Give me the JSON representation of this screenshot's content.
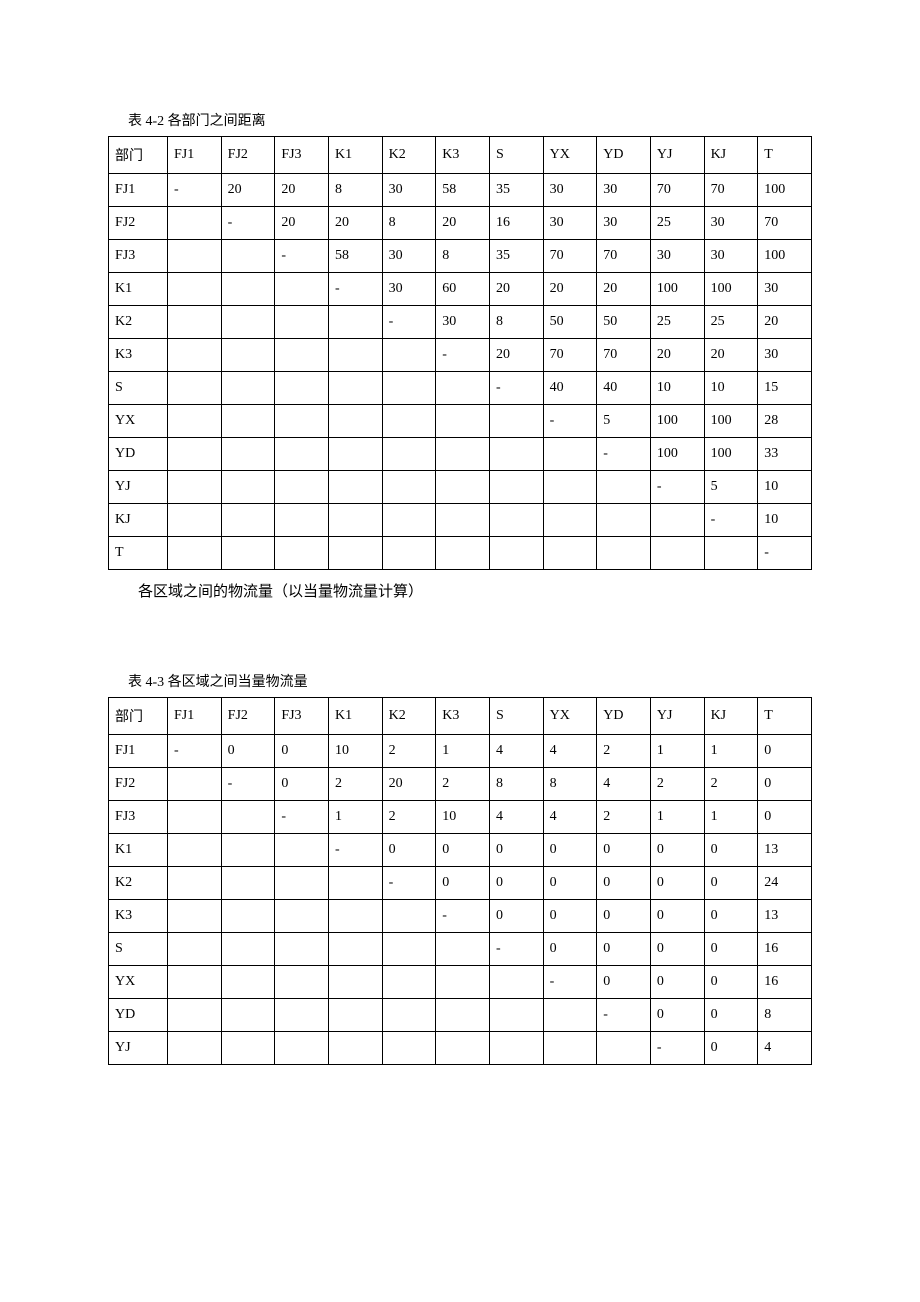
{
  "table1": {
    "caption": "表 4-2  各部门之间距离",
    "header": [
      "部门",
      "FJ1",
      "FJ2",
      "FJ3",
      "K1",
      "K2",
      "K3",
      "S",
      "YX",
      "YD",
      "YJ",
      "KJ",
      "T"
    ],
    "rows": [
      [
        "FJ1",
        "-",
        "20",
        "20",
        "8",
        "30",
        "58",
        "35",
        "30",
        "30",
        "70",
        "70",
        "100"
      ],
      [
        "FJ2",
        "",
        "-",
        "20",
        "20",
        "8",
        "20",
        "16",
        "30",
        "30",
        "25",
        "30",
        "70"
      ],
      [
        "FJ3",
        "",
        "",
        "-",
        "58",
        "30",
        "8",
        "35",
        "70",
        "70",
        "30",
        "30",
        "100"
      ],
      [
        "K1",
        "",
        "",
        "",
        "-",
        "30",
        "60",
        "20",
        "20",
        "20",
        "100",
        "100",
        "30"
      ],
      [
        "K2",
        "",
        "",
        "",
        "",
        "-",
        "30",
        "8",
        "50",
        "50",
        "25",
        "25",
        "20"
      ],
      [
        "K3",
        "",
        "",
        "",
        "",
        "",
        "-",
        "20",
        "70",
        "70",
        "20",
        "20",
        "30"
      ],
      [
        "S",
        "",
        "",
        "",
        "",
        "",
        "",
        "-",
        "40",
        "40",
        "10",
        "10",
        "15"
      ],
      [
        "YX",
        "",
        "",
        "",
        "",
        "",
        "",
        "",
        "-",
        "5",
        "100",
        "100",
        "28"
      ],
      [
        "YD",
        "",
        "",
        "",
        "",
        "",
        "",
        "",
        "",
        "-",
        "100",
        "100",
        "33"
      ],
      [
        "YJ",
        "",
        "",
        "",
        "",
        "",
        "",
        "",
        "",
        "",
        "-",
        "5",
        "10"
      ],
      [
        "KJ",
        "",
        "",
        "",
        "",
        "",
        "",
        "",
        "",
        "",
        "",
        "-",
        "10"
      ],
      [
        "T",
        "",
        "",
        "",
        "",
        "",
        "",
        "",
        "",
        "",
        "",
        "",
        "-"
      ]
    ]
  },
  "middleText": "各区域之间的物流量（以当量物流量计算）",
  "table2": {
    "caption": "表 4-3  各区域之间当量物流量",
    "header": [
      "部门",
      "FJ1",
      "FJ2",
      "FJ3",
      "K1",
      "K2",
      "K3",
      "S",
      "YX",
      "YD",
      "YJ",
      "KJ",
      "T"
    ],
    "rows": [
      [
        "FJ1",
        "-",
        "0",
        "0",
        "10",
        "2",
        "1",
        "4",
        "4",
        "2",
        "1",
        "1",
        "0"
      ],
      [
        "FJ2",
        "",
        "-",
        "0",
        "2",
        "20",
        "2",
        "8",
        "8",
        "4",
        "2",
        "2",
        "0"
      ],
      [
        "FJ3",
        "",
        "",
        "-",
        "1",
        "2",
        "10",
        "4",
        "4",
        "2",
        "1",
        "1",
        "0"
      ],
      [
        "K1",
        "",
        "",
        "",
        "-",
        "0",
        "0",
        "0",
        "0",
        "0",
        "0",
        "0",
        "13"
      ],
      [
        "K2",
        "",
        "",
        "",
        "",
        "-",
        "0",
        "0",
        "0",
        "0",
        "0",
        "0",
        "24"
      ],
      [
        "K3",
        "",
        "",
        "",
        "",
        "",
        "-",
        "0",
        "0",
        "0",
        "0",
        "0",
        "13"
      ],
      [
        "S",
        "",
        "",
        "",
        "",
        "",
        "",
        "-",
        "0",
        "0",
        "0",
        "0",
        "16"
      ],
      [
        "YX",
        "",
        "",
        "",
        "",
        "",
        "",
        "",
        "-",
        "0",
        "0",
        "0",
        "16"
      ],
      [
        "YD",
        "",
        "",
        "",
        "",
        "",
        "",
        "",
        "",
        "-",
        "0",
        "0",
        "8"
      ],
      [
        "YJ",
        "",
        "",
        "",
        "",
        "",
        "",
        "",
        "",
        "",
        "-",
        "0",
        "4"
      ]
    ]
  },
  "chart_data": [
    {
      "type": "table",
      "title": "表 4-2 各部门之间距离",
      "columns": [
        "部门",
        "FJ1",
        "FJ2",
        "FJ3",
        "K1",
        "K2",
        "K3",
        "S",
        "YX",
        "YD",
        "YJ",
        "KJ",
        "T"
      ],
      "rows": [
        {
          "部门": "FJ1",
          "FJ1": "-",
          "FJ2": 20,
          "FJ3": 20,
          "K1": 8,
          "K2": 30,
          "K3": 58,
          "S": 35,
          "YX": 30,
          "YD": 30,
          "YJ": 70,
          "KJ": 70,
          "T": 100
        },
        {
          "部门": "FJ2",
          "FJ2": "-",
          "FJ3": 20,
          "K1": 20,
          "K2": 8,
          "K3": 20,
          "S": 16,
          "YX": 30,
          "YD": 30,
          "YJ": 25,
          "KJ": 30,
          "T": 70
        },
        {
          "部门": "FJ3",
          "FJ3": "-",
          "K1": 58,
          "K2": 30,
          "K3": 8,
          "S": 35,
          "YX": 70,
          "YD": 70,
          "YJ": 30,
          "KJ": 30,
          "T": 100
        },
        {
          "部门": "K1",
          "K1": "-",
          "K2": 30,
          "K3": 60,
          "S": 20,
          "YX": 20,
          "YD": 20,
          "YJ": 100,
          "KJ": 100,
          "T": 30
        },
        {
          "部门": "K2",
          "K2": "-",
          "K3": 30,
          "S": 8,
          "YX": 50,
          "YD": 50,
          "YJ": 25,
          "KJ": 25,
          "T": 20
        },
        {
          "部门": "K3",
          "K3": "-",
          "S": 20,
          "YX": 70,
          "YD": 70,
          "YJ": 20,
          "KJ": 20,
          "T": 30
        },
        {
          "部门": "S",
          "S": "-",
          "YX": 40,
          "YD": 40,
          "YJ": 10,
          "KJ": 10,
          "T": 15
        },
        {
          "部门": "YX",
          "YX": "-",
          "YD": 5,
          "YJ": 100,
          "KJ": 100,
          "T": 28
        },
        {
          "部门": "YD",
          "YD": "-",
          "YJ": 100,
          "KJ": 100,
          "T": 33
        },
        {
          "部门": "YJ",
          "YJ": "-",
          "KJ": 5,
          "T": 10
        },
        {
          "部门": "KJ",
          "KJ": "-",
          "T": 10
        },
        {
          "部门": "T",
          "T": "-"
        }
      ]
    },
    {
      "type": "table",
      "title": "表 4-3 各区域之间当量物流量",
      "columns": [
        "部门",
        "FJ1",
        "FJ2",
        "FJ3",
        "K1",
        "K2",
        "K3",
        "S",
        "YX",
        "YD",
        "YJ",
        "KJ",
        "T"
      ],
      "rows": [
        {
          "部门": "FJ1",
          "FJ1": "-",
          "FJ2": 0,
          "FJ3": 0,
          "K1": 10,
          "K2": 2,
          "K3": 1,
          "S": 4,
          "YX": 4,
          "YD": 2,
          "YJ": 1,
          "KJ": 1,
          "T": 0
        },
        {
          "部门": "FJ2",
          "FJ2": "-",
          "FJ3": 0,
          "K1": 2,
          "K2": 20,
          "K3": 2,
          "S": 8,
          "YX": 8,
          "YD": 4,
          "YJ": 2,
          "KJ": 2,
          "T": 0
        },
        {
          "部门": "FJ3",
          "FJ3": "-",
          "K1": 1,
          "K2": 2,
          "K3": 10,
          "S": 4,
          "YX": 4,
          "YD": 2,
          "YJ": 1,
          "KJ": 1,
          "T": 0
        },
        {
          "部门": "K1",
          "K1": "-",
          "K2": 0,
          "K3": 0,
          "S": 0,
          "YX": 0,
          "YD": 0,
          "YJ": 0,
          "KJ": 0,
          "T": 13
        },
        {
          "部门": "K2",
          "K2": "-",
          "K3": 0,
          "S": 0,
          "YX": 0,
          "YD": 0,
          "YJ": 0,
          "KJ": 0,
          "T": 24
        },
        {
          "部门": "K3",
          "K3": "-",
          "S": 0,
          "YX": 0,
          "YD": 0,
          "YJ": 0,
          "KJ": 0,
          "T": 13
        },
        {
          "部门": "S",
          "S": "-",
          "YX": 0,
          "YD": 0,
          "YJ": 0,
          "KJ": 0,
          "T": 16
        },
        {
          "部门": "YX",
          "YX": "-",
          "YD": 0,
          "YJ": 0,
          "KJ": 0,
          "T": 16
        },
        {
          "部门": "YD",
          "YD": "-",
          "YJ": 0,
          "KJ": 0,
          "T": 8
        },
        {
          "部门": "YJ",
          "YJ": "-",
          "KJ": 0,
          "T": 4
        }
      ]
    }
  ]
}
